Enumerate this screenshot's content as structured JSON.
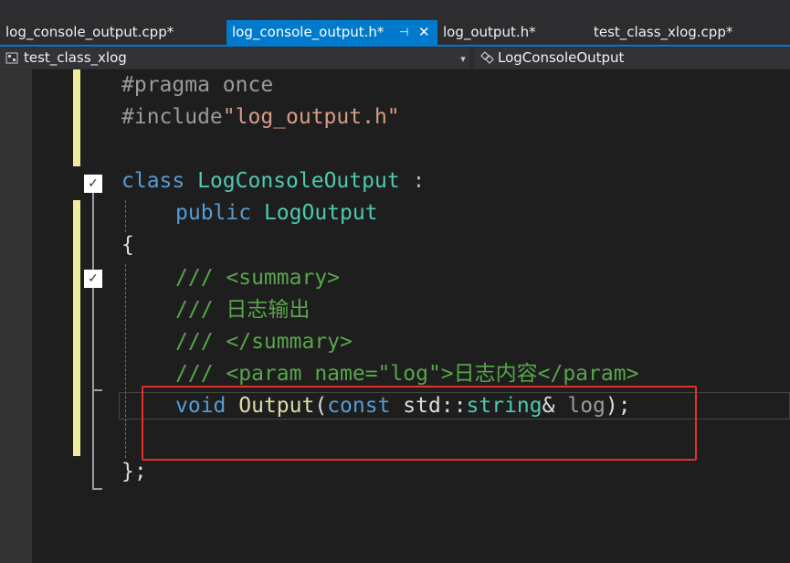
{
  "tabs": [
    {
      "label": "log_console_output.cpp*",
      "active": false
    },
    {
      "label": "log_console_output.h*",
      "active": true
    },
    {
      "label": "log_output.h*",
      "active": false
    },
    {
      "label": "test_class_xlog.cpp*",
      "active": false
    }
  ],
  "tab_pin_glyph": "⊣",
  "tab_close_glyph": "✕",
  "nav": {
    "left": "test_class_xlog",
    "right": "LogConsoleOutput",
    "dropdown_glyph": "▾"
  },
  "fold_glyph": "✓",
  "code": {
    "l1": {
      "a": "#pragma once"
    },
    "l2": {
      "a": "#include",
      "b": "\"log_output.h\""
    },
    "l3": {
      "a": "class",
      "b": " ",
      "c": "LogConsoleOutput",
      "d": " :"
    },
    "l4": {
      "a": "public",
      "b": " ",
      "c": "LogOutput"
    },
    "l5": {
      "a": "{"
    },
    "l6": {
      "a": "/// <summary>"
    },
    "l7": {
      "a": "/// 日志输出"
    },
    "l8": {
      "a": "/// </summary>"
    },
    "l9": {
      "a": "/// <param name=\"log\">日志内容</param>"
    },
    "l10": {
      "a": "void",
      "b": " ",
      "c": "Output",
      "d": "(",
      "e": "const",
      "f": " std::",
      "g": "string",
      "h": "& ",
      "i": "log",
      "j": ");"
    },
    "l11": {
      "a": "};"
    }
  },
  "colors": {
    "accent": "#007acc",
    "annotation": "#e8302a",
    "change_marker": "#efef9b"
  }
}
